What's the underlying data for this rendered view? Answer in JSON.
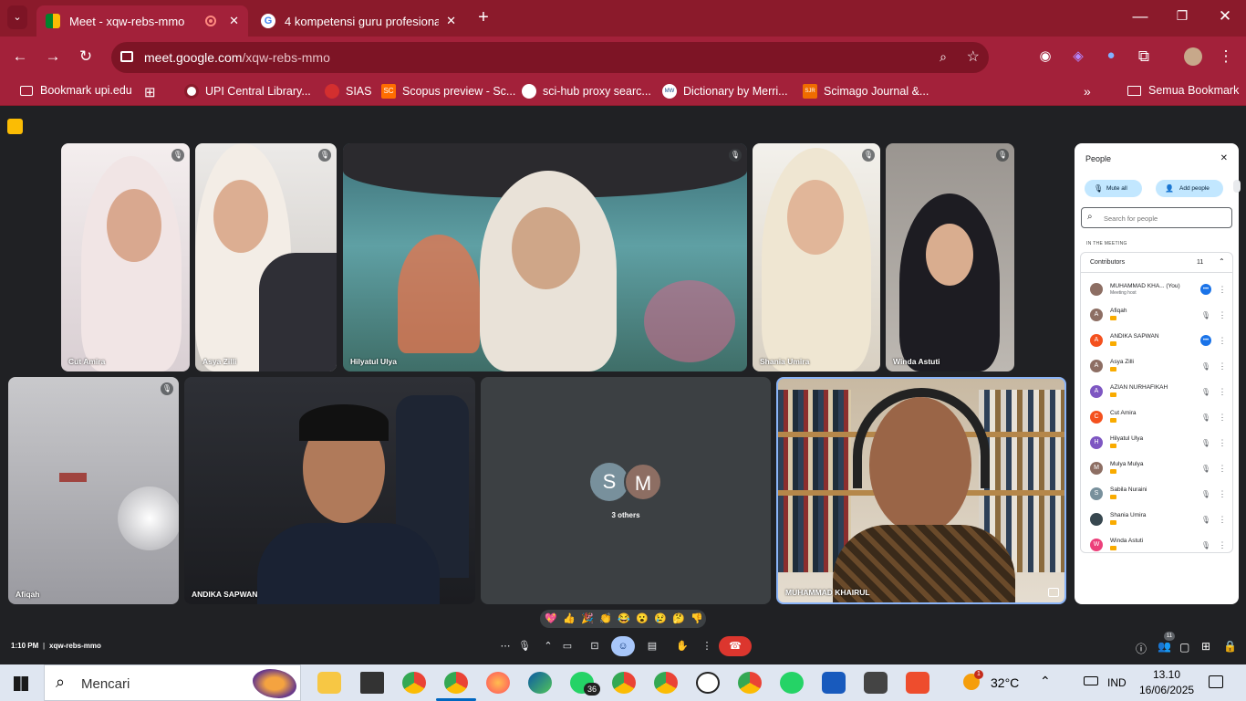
{
  "browser": {
    "tabs": [
      {
        "title": "Meet - xqw-rebs-mmo",
        "active": true
      },
      {
        "title": "4 kompetensi guru profesional",
        "active": false
      }
    ],
    "url_host": "meet.google.com",
    "url_path": "/xqw-rebs-mmo",
    "bookmarks": [
      "Bookmark upi.edu",
      "UPI Central Library...",
      "SIAS",
      "Scopus preview - Sc...",
      "sci-hub proxy searc...",
      "Dictionary by Merri...",
      "Scimago Journal &...",
      "Semua Bookmark"
    ],
    "bookmark_badges": {
      "scopus": "SC",
      "merriam": "MW",
      "scimago": "SJR"
    }
  },
  "tiles": [
    {
      "name": "Cut Amira"
    },
    {
      "name": "Asya Zilli"
    },
    {
      "name": "Hilyatul Ulya"
    },
    {
      "name": "Shania Umira"
    },
    {
      "name": "Winda Astuti"
    },
    {
      "name": "Afiqah"
    },
    {
      "name": "ANDIKA SAPWAN"
    },
    {
      "name": "MUHAMMAD KHAIRUL"
    }
  ],
  "others": {
    "avatars": [
      "S",
      "M"
    ],
    "label": "3 others"
  },
  "people_panel": {
    "title": "People",
    "mute_all": "Mute all",
    "add_people": "Add people",
    "search_placeholder": "Search for people",
    "section": "IN THE MEETING",
    "group": "Contributors",
    "count": "11",
    "participants": [
      {
        "name": "MUHAMMAD KHA... (You)",
        "sub": "Meeting host",
        "avatar": "",
        "color": "#8d6e63"
      },
      {
        "name": "Afiqah",
        "avatar": "A",
        "color": "#8d6e63"
      },
      {
        "name": "ANDIKA SAPWAN",
        "avatar": "A",
        "color": "#f4511e"
      },
      {
        "name": "Asya Zilli",
        "avatar": "A",
        "color": "#8d6e63"
      },
      {
        "name": "AZIAN NURHAFIKAH",
        "avatar": "A",
        "color": "#7e57c2"
      },
      {
        "name": "Cut Amira",
        "avatar": "C",
        "color": "#f4511e"
      },
      {
        "name": "Hilyatul Ulya",
        "avatar": "H",
        "color": "#7e57c2"
      },
      {
        "name": "Mulya Mulya",
        "avatar": "M",
        "color": "#8d6e63"
      },
      {
        "name": "Sabila Nuraini",
        "avatar": "S",
        "color": "#78909c"
      },
      {
        "name": "Shania Umira",
        "avatar": "",
        "color": "#37474f"
      },
      {
        "name": "Winda Astuti",
        "avatar": "W",
        "color": "#ec407a"
      }
    ]
  },
  "reactions": [
    "💖",
    "👍",
    "🎉",
    "👏",
    "😂",
    "😮",
    "😢",
    "🤔",
    "👎"
  ],
  "bottom": {
    "time": "1:10 PM",
    "code": "xqw-rebs-mmo",
    "people_badge": "11"
  },
  "taskbar": {
    "search": "Mencari",
    "whatsapp_badge": "36",
    "weather_badge": "1",
    "temp": "32°C",
    "lang": "IND",
    "clock_time": "13.10",
    "clock_date": "16/06/2025"
  }
}
